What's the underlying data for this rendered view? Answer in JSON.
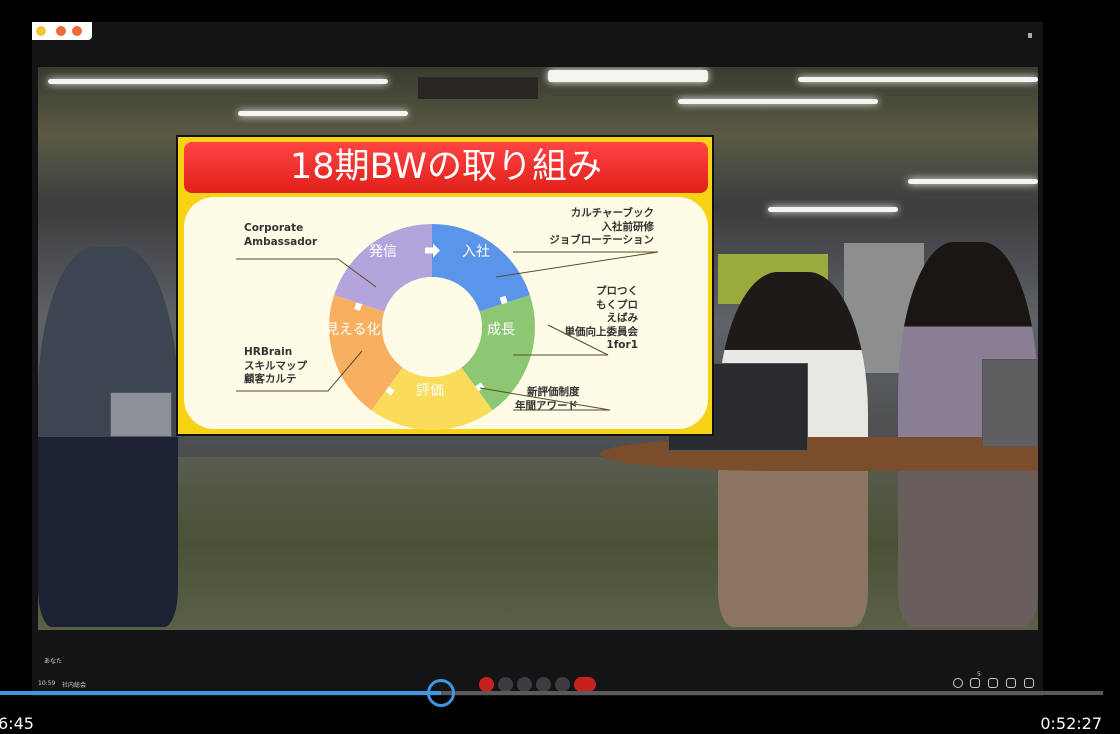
{
  "meeting": {
    "self_label": "あなた",
    "clock": "10:59",
    "meeting_name": "社内総会",
    "participant_count": "5"
  },
  "slide": {
    "title": "18期BWの取り組み",
    "segments": [
      {
        "label": "入社",
        "color": "#5b95ea"
      },
      {
        "label": "成長",
        "color": "#8cc874"
      },
      {
        "label": "評価",
        "color": "#fbdc5a"
      },
      {
        "label": "見える化",
        "color": "#f8b060"
      },
      {
        "label": "発信",
        "color": "#b3a5dc"
      }
    ],
    "notes": {
      "nyusha": [
        "カルチャーブック",
        "入社前研修",
        "ジョブローテーション"
      ],
      "seicho": [
        "プロつく",
        "もくプロ",
        "えばみ",
        "単価向上委員会",
        "1for1"
      ],
      "hyoka": [
        "新評価制度",
        "年間アワード"
      ],
      "mieruka": [
        "HRBrain",
        "スキルマップ",
        "顧客カルテ"
      ],
      "hasshin": [
        "Corporate",
        "Ambassador"
      ]
    }
  },
  "player": {
    "elapsed": "6:45",
    "duration": "0:52:27",
    "progress_fraction": 0.4,
    "accent": "#3e97e0"
  }
}
